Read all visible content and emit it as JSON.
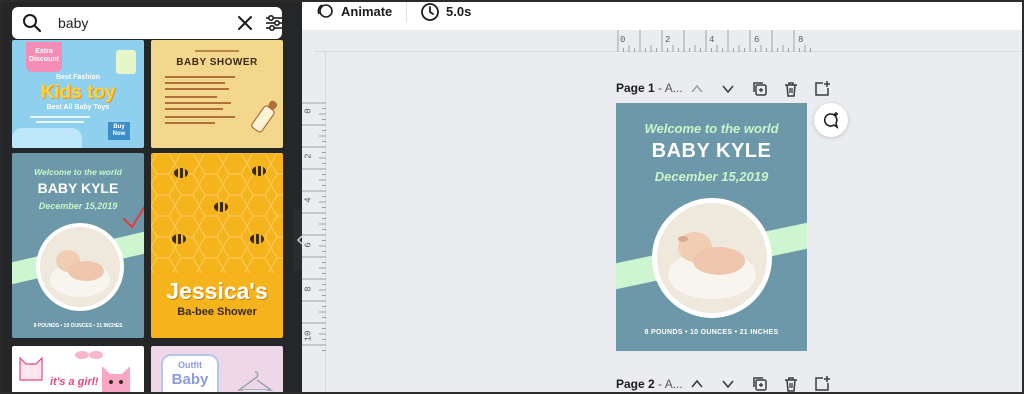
{
  "search": {
    "value": "baby"
  },
  "results": {
    "kids_toy": {
      "badge": "Extra Discount",
      "line1": "Best Fashion",
      "title": "Kids toy",
      "line3": "Best All Baby Toys",
      "buy": "Buy Now"
    },
    "baby_shower": {
      "title": "BABY SHOWER"
    },
    "baby_kyle": {
      "welcome": "Welcome to the world",
      "name": "BABY KYLE",
      "date": "December 15,2019",
      "stats": "8 POUNDS • 10 OUNCES • 21 INCHES"
    },
    "jessica": {
      "name": "Jessica's",
      "subtitle": "Ba-bee Shower"
    },
    "girl": {
      "text": "it's a girl!"
    },
    "outfit": {
      "line1": "Outfit",
      "line2": "Baby"
    }
  },
  "toolbar": {
    "animate_label": "Animate",
    "duration": "5.0s"
  },
  "ruler": {
    "h_ticks": [
      "0",
      "2",
      "4",
      "6",
      "8"
    ],
    "v_ticks": [
      "0",
      "2",
      "4",
      "6",
      "8",
      "10"
    ]
  },
  "pages": [
    {
      "label": "Page 1",
      "suffix": " - A..."
    },
    {
      "label": "Page 2",
      "suffix": " - A..."
    }
  ],
  "design": {
    "welcome": "Welcome to the world",
    "name": "BABY KYLE",
    "date": "December 15,2019",
    "stats": "8 POUNDS • 10 OUNCES • 21 INCHES"
  },
  "colors": {
    "panel_bg": "#252627",
    "workspace_bg": "#ebecf0",
    "design_blue": "#6d98a9",
    "mint": "#c9f5c9",
    "honey": "#f5b31c"
  }
}
